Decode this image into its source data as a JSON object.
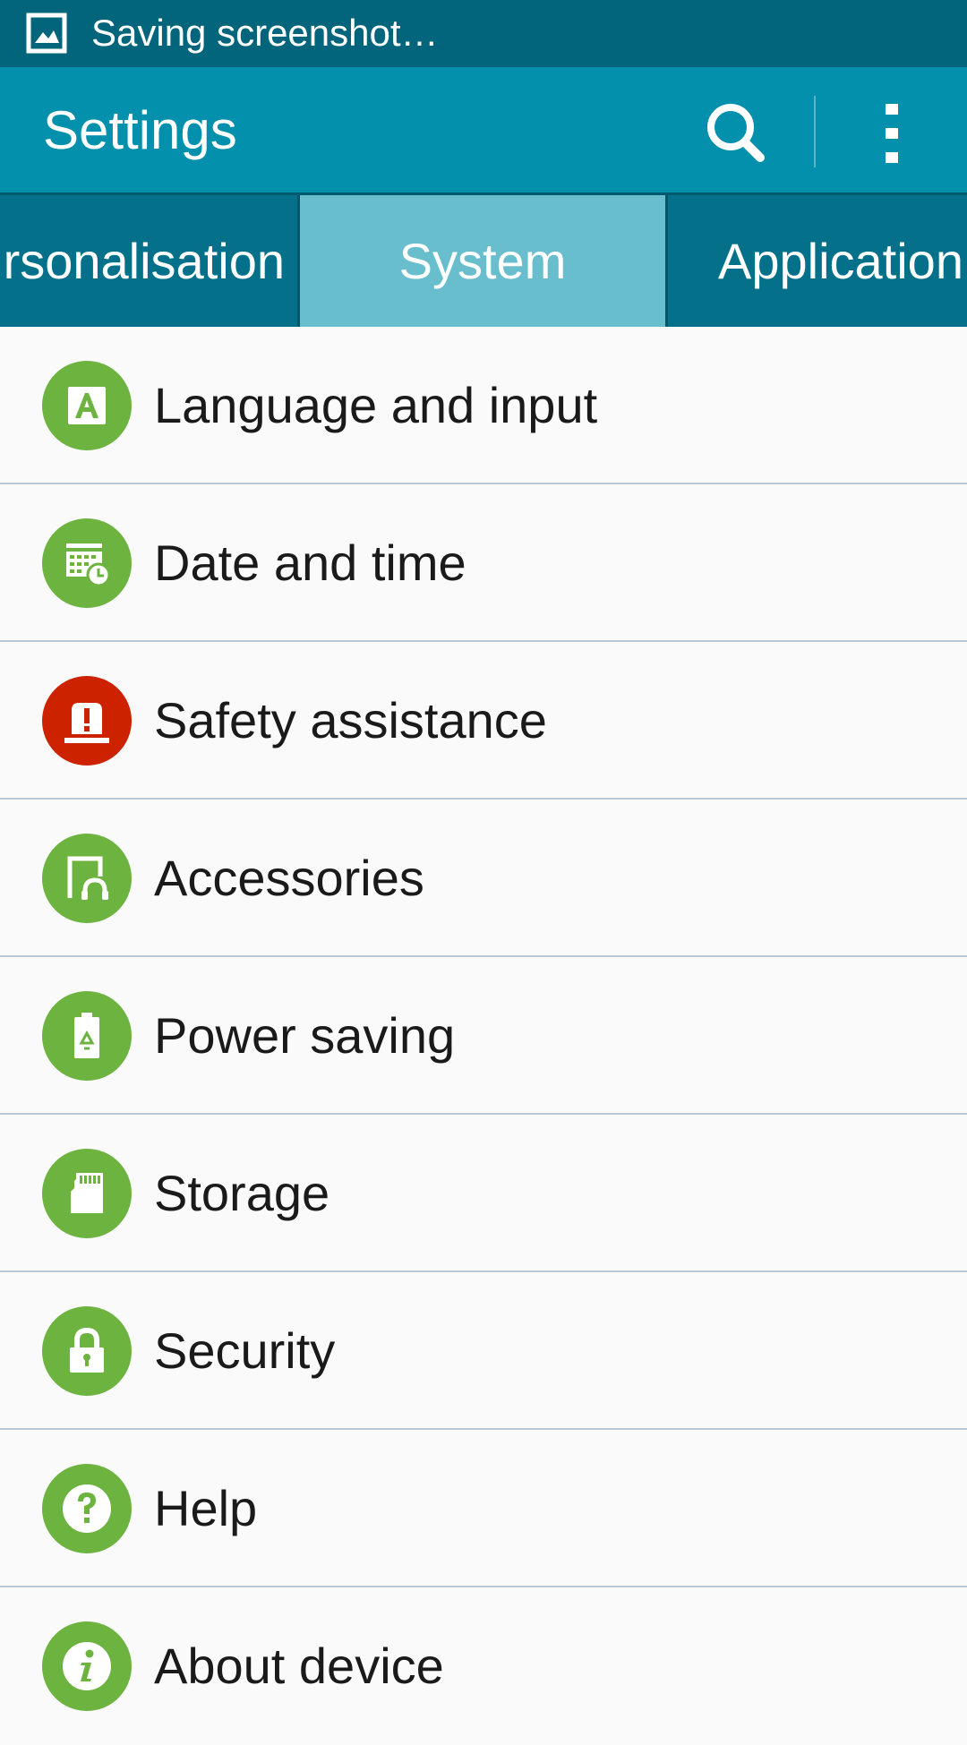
{
  "status_bar": {
    "notification_text": "Saving screenshot…",
    "icon": "image-icon"
  },
  "action_bar": {
    "title": "Settings",
    "search_icon": "search-icon",
    "overflow_icon": "more-vert-icon"
  },
  "tabs": [
    {
      "label": "Personalisation",
      "visible_text": "rsonalisation",
      "selected": false
    },
    {
      "label": "System",
      "visible_text": "System",
      "selected": true
    },
    {
      "label": "Applications",
      "visible_text": "Application",
      "selected": false
    }
  ],
  "items": [
    {
      "label": "Language and input",
      "icon": "language-icon",
      "icon_color": "#6db33f"
    },
    {
      "label": "Date and time",
      "icon": "calendar-clock-icon",
      "icon_color": "#6db33f"
    },
    {
      "label": "Safety assistance",
      "icon": "alert-beacon-icon",
      "icon_color": "#cc2200"
    },
    {
      "label": "Accessories",
      "icon": "accessories-icon",
      "icon_color": "#6db33f"
    },
    {
      "label": "Power saving",
      "icon": "battery-recycle-icon",
      "icon_color": "#6db33f"
    },
    {
      "label": "Storage",
      "icon": "sd-card-icon",
      "icon_color": "#6db33f"
    },
    {
      "label": "Security",
      "icon": "lock-icon",
      "icon_color": "#6db33f"
    },
    {
      "label": "Help",
      "icon": "help-icon",
      "icon_color": "#6db33f"
    },
    {
      "label": "About device",
      "icon": "info-icon",
      "icon_color": "#6db33f"
    }
  ],
  "colors": {
    "status_bar": "#03657c",
    "action_bar": "#0390ad",
    "tab_bar": "#04708a",
    "tab_selected": "#69bece",
    "list_background": "#fafafa",
    "divider": "#b7c8d4"
  }
}
